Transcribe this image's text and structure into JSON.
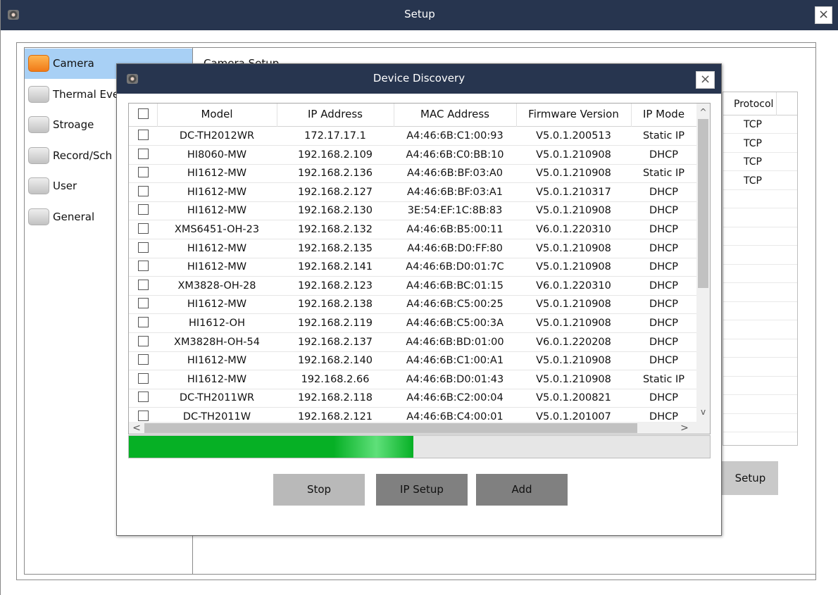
{
  "setup": {
    "title": "Setup",
    "close": "×",
    "content_heading": "Camera Setup",
    "nav": [
      {
        "label": "Camera",
        "selected": true
      },
      {
        "label": "Thermal Eve",
        "selected": false
      },
      {
        "label": "Stroage",
        "selected": false
      },
      {
        "label": "Record/Sch",
        "selected": false
      },
      {
        "label": "User",
        "selected": false
      },
      {
        "label": "General",
        "selected": false
      }
    ],
    "bg_table": {
      "header": "Protocol",
      "rows": [
        "TCP",
        "TCP",
        "TCP",
        "TCP"
      ]
    },
    "bg_ipsetup_label": "Setup"
  },
  "dialog": {
    "title": "Device Discovery",
    "close": "×",
    "columns": {
      "model": "Model",
      "ip": "IP Address",
      "mac": "MAC Address",
      "firmware": "Firmware Version",
      "mode": "IP Mode"
    },
    "devices": [
      {
        "model": "DC-TH2012WR",
        "ip": "172.17.17.1",
        "mac": "A4:46:6B:C1:00:93",
        "firmware": "V5.0.1.200513",
        "mode": "Static IP"
      },
      {
        "model": "HI8060-MW",
        "ip": "192.168.2.109",
        "mac": "A4:46:6B:C0:BB:10",
        "firmware": "V5.0.1.210908",
        "mode": "DHCP"
      },
      {
        "model": "HI1612-MW",
        "ip": "192.168.2.136",
        "mac": "A4:46:6B:BF:03:A0",
        "firmware": "V5.0.1.210908",
        "mode": "Static IP"
      },
      {
        "model": "HI1612-MW",
        "ip": "192.168.2.127",
        "mac": "A4:46:6B:BF:03:A1",
        "firmware": "V5.0.1.210317",
        "mode": "DHCP"
      },
      {
        "model": "HI1612-MW",
        "ip": "192.168.2.130",
        "mac": "3E:54:EF:1C:8B:83",
        "firmware": "V5.0.1.210908",
        "mode": "DHCP"
      },
      {
        "model": "XMS6451-OH-23",
        "ip": "192.168.2.132",
        "mac": "A4:46:6B:B5:00:11",
        "firmware": "V6.0.1.220310",
        "mode": "DHCP"
      },
      {
        "model": "HI1612-MW",
        "ip": "192.168.2.135",
        "mac": "A4:46:6B:D0:FF:80",
        "firmware": "V5.0.1.210908",
        "mode": "DHCP"
      },
      {
        "model": "HI1612-MW",
        "ip": "192.168.2.141",
        "mac": "A4:46:6B:D0:01:7C",
        "firmware": "V5.0.1.210908",
        "mode": "DHCP"
      },
      {
        "model": "XM3828-OH-28",
        "ip": "192.168.2.123",
        "mac": "A4:46:6B:BC:01:15",
        "firmware": "V6.0.1.220310",
        "mode": "DHCP"
      },
      {
        "model": "HI1612-MW",
        "ip": "192.168.2.138",
        "mac": "A4:46:6B:C5:00:25",
        "firmware": "V5.0.1.210908",
        "mode": "DHCP"
      },
      {
        "model": "HI1612-OH",
        "ip": "192.168.2.119",
        "mac": "A4:46:6B:C5:00:3A",
        "firmware": "V5.0.1.210908",
        "mode": "DHCP"
      },
      {
        "model": "XM3828H-OH-54",
        "ip": "192.168.2.137",
        "mac": "A4:46:6B:BD:01:00",
        "firmware": "V6.0.1.220208",
        "mode": "DHCP"
      },
      {
        "model": "HI1612-MW",
        "ip": "192.168.2.140",
        "mac": "A4:46:6B:C1:00:A1",
        "firmware": "V5.0.1.210908",
        "mode": "DHCP"
      },
      {
        "model": "HI1612-MW",
        "ip": "192.168.2.66",
        "mac": "A4:46:6B:D0:01:43",
        "firmware": "V5.0.1.210908",
        "mode": "Static IP"
      },
      {
        "model": "DC-TH2011WR",
        "ip": "192.168.2.118",
        "mac": "A4:46:6B:C2:00:04",
        "firmware": "V5.0.1.200821",
        "mode": "DHCP"
      },
      {
        "model": "DC-TH2011W",
        "ip": "192.168.2.121",
        "mac": "A4:46:6B:C4:00:01",
        "firmware": "V5.0.1.201007",
        "mode": "DHCP"
      }
    ],
    "progress_percent": 49,
    "buttons": {
      "stop": "Stop",
      "ip_setup": "IP Setup",
      "add": "Add"
    },
    "scroll": {
      "up": "^",
      "down": "v",
      "left": "<",
      "right": ">"
    }
  },
  "colors": {
    "titlebar": "#27354f",
    "nav_selected": "#a8d0f5",
    "progress": "#06b025"
  }
}
